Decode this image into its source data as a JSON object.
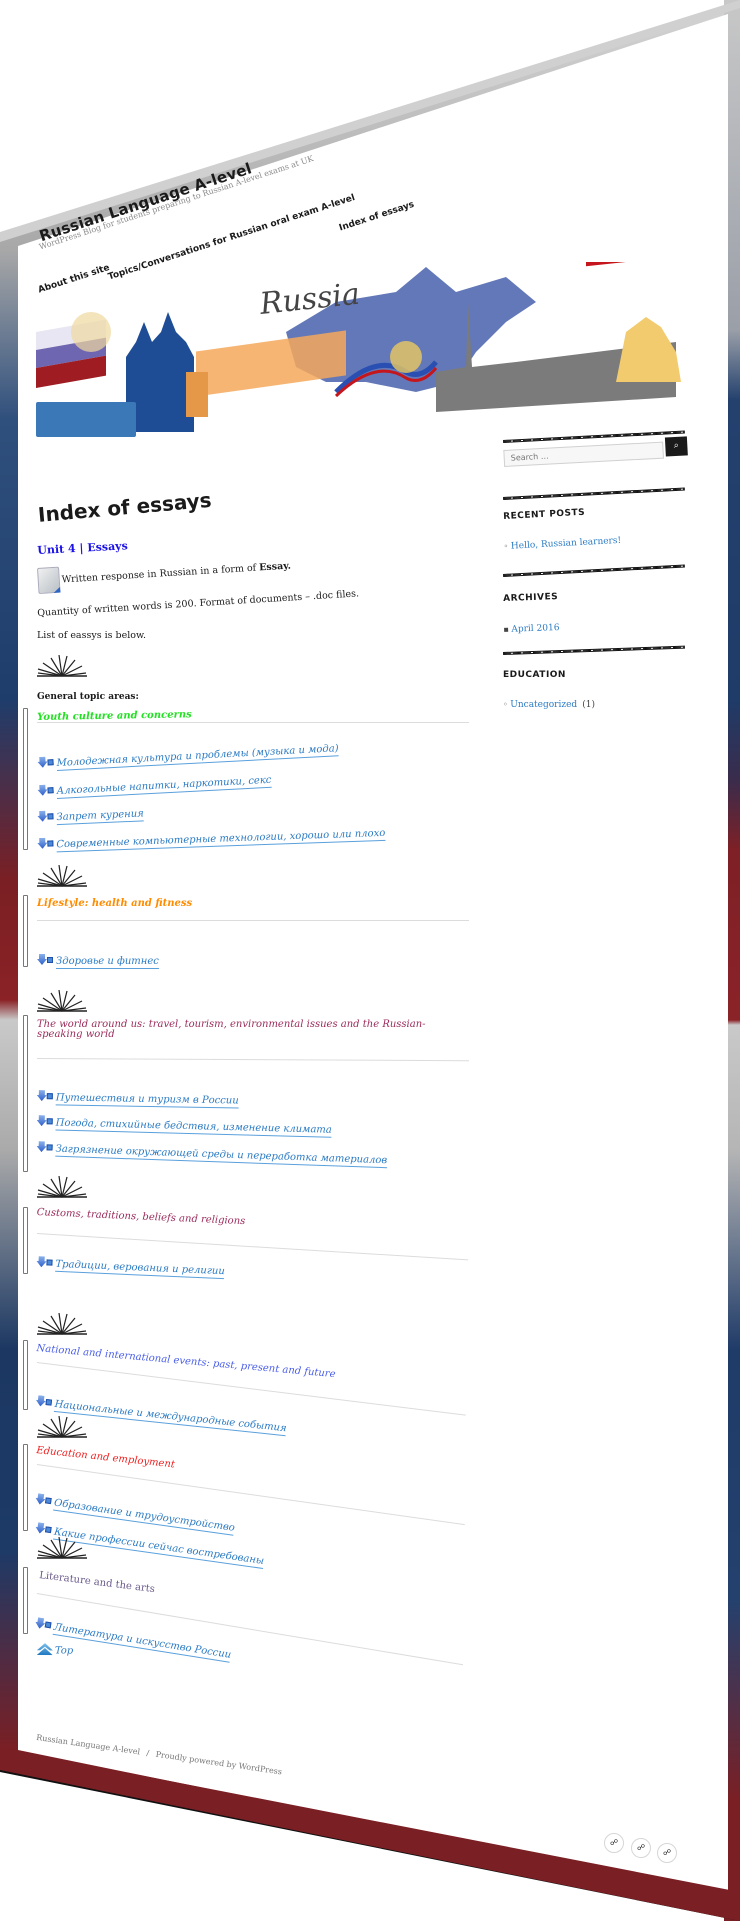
{
  "site": {
    "title": "Russian Language A-level",
    "description": "WordPress Blog for students preparing to Russian A-level exams at UK"
  },
  "nav": {
    "items": [
      {
        "label": "About this site"
      },
      {
        "label": "Topics/Conversations for Russian oral exam A-level"
      },
      {
        "label": "Index of essays"
      }
    ]
  },
  "banner": {
    "caption": "Russia",
    "colors": {
      "flag_white": "#ffffff",
      "flag_blue": "#1f3fa0",
      "flag_red": "#c4161c",
      "map_blue": "#6378b8",
      "railing_orange": "#f5a85a",
      "cathedral_blue": "#1e4d96",
      "skyline_gray": "#7b7b7b",
      "statue_gold": "#f1cb6e"
    }
  },
  "main": {
    "page_title": "Index of essays",
    "unit_title": "Unit 4 | Essays",
    "intro_line": "Written response in Russian in a form of ",
    "intro_bold": "Essay.",
    "quantity_line": "Quantity of written words  is  200. Format of documents  –  .doc files.",
    "list_intro": "List of eassys is below.",
    "general_topics_label": "General topic areas:",
    "top_link": "Top",
    "topics": [
      {
        "heading": "Youth culture and concerns",
        "color": "#22e022",
        "essays": [
          "Молодежная культура и проблемы (музыка и мода)",
          "Алкогольные напитки, наркотики, секс",
          "Запрет курения",
          "Современные компьютерные технологии, хорошо или плохо"
        ]
      },
      {
        "heading": "Lifestyle: health and fitness",
        "color": "#ff8c00",
        "essays": [
          "Здоровье и фитнес"
        ]
      },
      {
        "heading": "The world around us: travel, tourism, environmental issues and  the Russian-speaking world",
        "color": "#9b2c5c",
        "essays": [
          "Путешествия и туризм в России",
          "Погода, стихийные бедствия, изменение климата",
          "Загрязнение окружающей среды и переработка материалов"
        ]
      },
      {
        "heading": "Customs, traditions, beliefs and religions",
        "color": "#9b2c5c",
        "essays": [
          "Традиции, верования и религии"
        ]
      },
      {
        "heading": "National and international events: past, present and future",
        "color": "#4a5ee8",
        "essays": [
          "Национальные и международные события"
        ]
      },
      {
        "heading": "Education and employment",
        "color": "#f02020",
        "essays": [
          "Образование и трудоустройство",
          "Какие профессии сейчас востребованы"
        ]
      },
      {
        "heading": "Literature and the arts",
        "color": "#6a5a8c",
        "essays": [
          "Литература и искусство России"
        ]
      }
    ]
  },
  "sidebar": {
    "search_placeholder": "Search …",
    "search_button_icon": "search-icon",
    "recent_posts": {
      "title": "RECENT POSTS",
      "items": [
        "Hello, Russian learners!"
      ]
    },
    "archives": {
      "title": "ARCHIVES",
      "items": [
        "April 2016"
      ]
    },
    "categories": {
      "title": "EDUCATION",
      "items": [
        {
          "label": "Uncategorized",
          "count": "(1)"
        }
      ]
    }
  },
  "footer": {
    "site_name": "Russian Language A-level",
    "separator": "/",
    "powered_by": "Proudly powered by WordPress"
  },
  "social": {
    "buttons": [
      {
        "icon": "share-icon-1",
        "glyph": "☍"
      },
      {
        "icon": "share-icon-2",
        "glyph": "☍"
      },
      {
        "icon": "share-icon-3",
        "glyph": "☍"
      }
    ]
  },
  "theme": {
    "link_color": "#2b7bc4",
    "frame_blue": "#1f3d6b",
    "frame_red": "#7a1f24",
    "frame_gray": "#c9c9c9"
  }
}
